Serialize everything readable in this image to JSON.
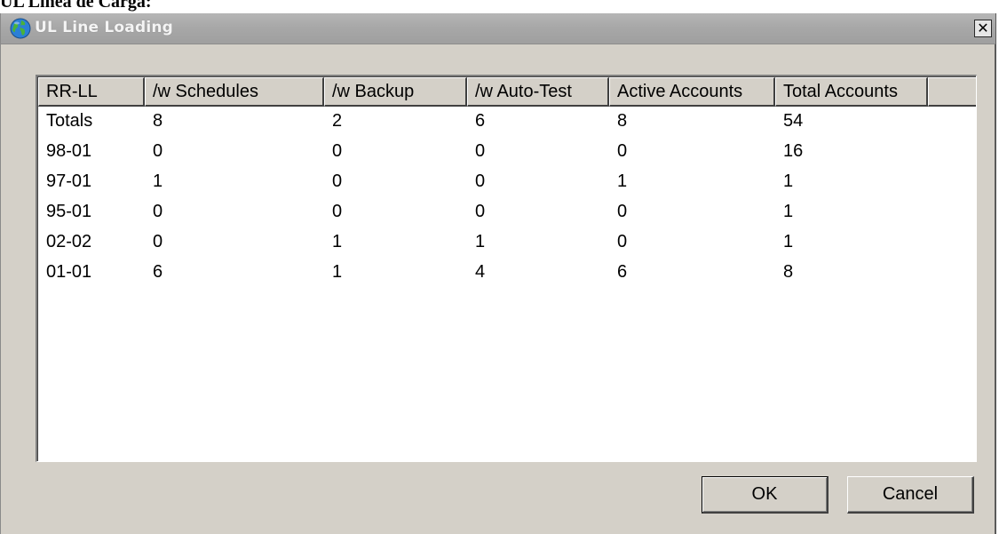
{
  "document": {
    "caption": "UL Línea de Carga:"
  },
  "window": {
    "title": "UL Line Loading",
    "title_icon": "globe-icon",
    "close_glyph": "✕"
  },
  "table": {
    "columns": [
      "RR-LL",
      "/w Schedules",
      "/w Backup",
      "/w Auto-Test",
      "Active Accounts",
      "Total Accounts"
    ],
    "rows": [
      [
        "Totals",
        "8",
        "2",
        "6",
        "8",
        "54"
      ],
      [
        "98-01",
        "0",
        "0",
        "0",
        "0",
        "16"
      ],
      [
        "97-01",
        "1",
        "0",
        "0",
        "1",
        "1"
      ],
      [
        "95-01",
        "0",
        "0",
        "0",
        "0",
        "1"
      ],
      [
        "02-02",
        "0",
        "1",
        "1",
        "0",
        "1"
      ],
      [
        "01-01",
        "6",
        "1",
        "4",
        "6",
        "8"
      ]
    ]
  },
  "buttons": {
    "ok_label": "OK",
    "cancel_label": "Cancel"
  }
}
